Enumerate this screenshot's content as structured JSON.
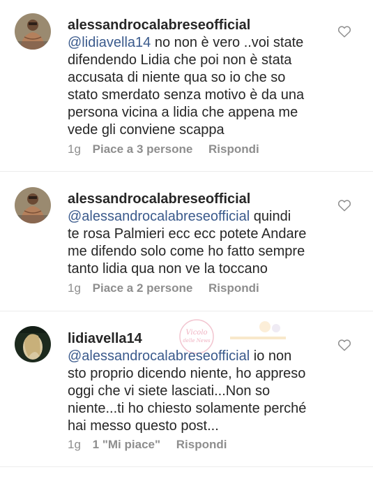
{
  "comments": [
    {
      "username": "alessandrocalabreseofficial",
      "mention": "@lidiavella14",
      "lines": [
        " no non è vero ..voi state",
        "difendendo Lidia che poi non è stata",
        "accusata di niente qua so io che so",
        "stato smerdato senza motivo è da una",
        "persona vicina a lidia che appena me",
        "vede gli conviene scappa"
      ],
      "time": "1g",
      "likes": "Piace a 3 persone",
      "reply": "Rispondi",
      "avatar": "shirtless-man-avatar"
    },
    {
      "username": "alessandrocalabreseofficial",
      "mention": "@alessandrocalabreseofficial",
      "lines": [
        " quindi",
        "te rosa Palmieri ecc ecc potete Andare",
        "me difendo solo come ho fatto sempre",
        "tanto lidia qua non ve la toccano"
      ],
      "time": "1g",
      "likes": "Piace a 2 persone",
      "reply": "Rispondi",
      "avatar": "shirtless-man-avatar"
    },
    {
      "username": "lidiavella14",
      "mention": "@alessandrocalabreseofficial",
      "lines": [
        " io non",
        "sto proprio dicendo niente, ho appreso",
        "oggi che vi siete lasciati...Non so",
        "niente...ti ho chiesto solamente perché",
        "hai messo questo post..."
      ],
      "time": "1g",
      "likes": "1 \"Mi piace\"",
      "reply": "Rispondi",
      "avatar": "woman-avatar"
    }
  ],
  "watermark_text": "Vicolo delle News",
  "colors": {
    "text": "#262626",
    "mention": "#3a5a8c",
    "meta": "#8e8e8e",
    "divider": "#ececec",
    "heart": "#8e8e8e"
  },
  "icons": {
    "like": "heart-outline-icon"
  }
}
